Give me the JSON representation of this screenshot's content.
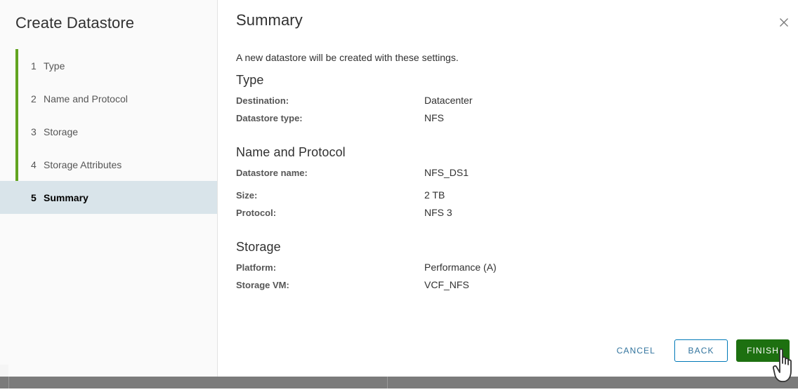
{
  "wizard": {
    "title": "Create Datastore",
    "close_icon": "close-icon",
    "steps": [
      {
        "num": "1",
        "label": "Type",
        "active": false
      },
      {
        "num": "2",
        "label": "Name and Protocol",
        "active": false
      },
      {
        "num": "3",
        "label": "Storage",
        "active": false
      },
      {
        "num": "4",
        "label": "Storage Attributes",
        "active": false
      },
      {
        "num": "5",
        "label": "Summary",
        "active": true
      }
    ],
    "rail_color": "#62a420",
    "active_step_bg": "#d9e4ea"
  },
  "page": {
    "heading": "Summary",
    "intro": "A new datastore will be created with these settings.",
    "sections": [
      {
        "title": "Type",
        "rows": [
          {
            "key": "Destination:",
            "value": "Datacenter"
          },
          {
            "key": "Datastore type:",
            "value": "NFS"
          }
        ]
      },
      {
        "title": "Name and Protocol",
        "rows": [
          {
            "key": "Datastore name:",
            "value": "NFS_DS1"
          },
          {
            "key": "Size:",
            "value": "2 TB"
          },
          {
            "key": "Protocol:",
            "value": "NFS 3"
          }
        ]
      },
      {
        "title": "Storage",
        "rows": [
          {
            "key": "Platform:",
            "value": "Performance (A)"
          },
          {
            "key": "Storage VM:",
            "value": "VCF_NFS"
          }
        ]
      }
    ]
  },
  "footer": {
    "cancel_label": "CANCEL",
    "back_label": "BACK",
    "finish_label": "FINISH",
    "link_color": "#31739d",
    "outline_color": "#0079b8",
    "finish_bg": "#1d7010"
  },
  "cursor": {
    "icon": "pointing-hand-cursor"
  }
}
